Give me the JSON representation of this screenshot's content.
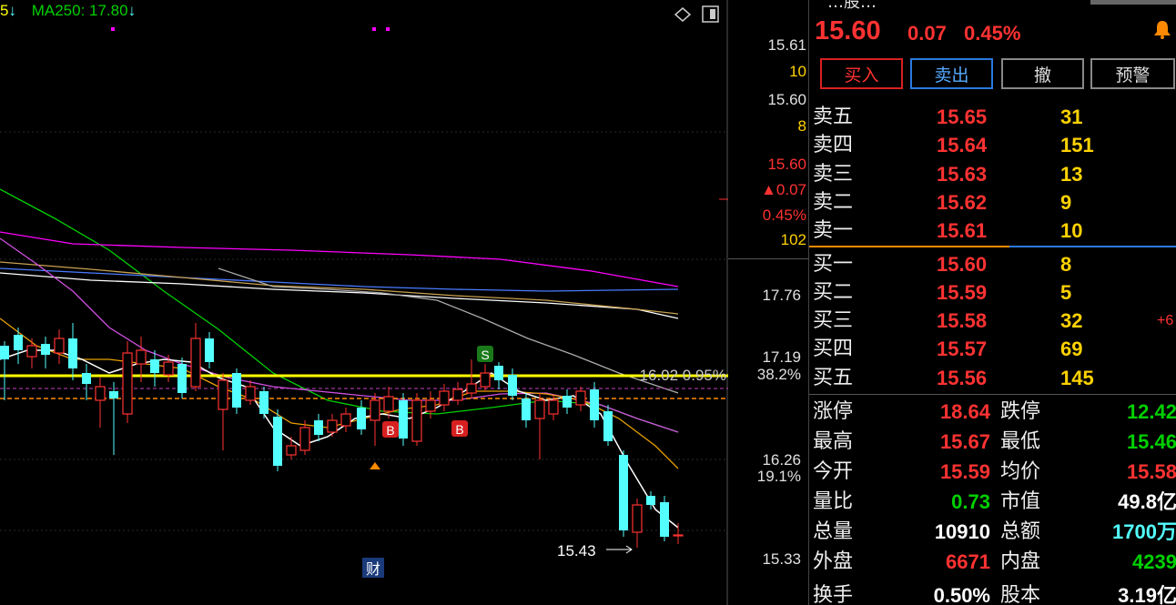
{
  "chart_header": {
    "ma_prefix": "5",
    "ma250_label": "MA250: 17.80",
    "arrow": "↓"
  },
  "chart_annotations": {
    "marker_s": "S",
    "marker_b1": "B",
    "marker_b2": "B",
    "fib_label": "16.02 0.95%",
    "low_label": "15.43",
    "finance_badge": "财"
  },
  "right_axis": {
    "labels": [
      "15.61",
      "10",
      "15.60",
      "8",
      "15.60",
      "▲0.07",
      "0.45%",
      "102",
      "17.76",
      "17.19",
      "38.2%",
      "16.26",
      "19.1%",
      "15.33"
    ]
  },
  "quote": {
    "last_price": "15.60",
    "change": "0.07",
    "change_pct": "0.45%",
    "name_partial": "…股…"
  },
  "buttons": {
    "buy": "买入",
    "sell": "卖出",
    "cancel": "撤",
    "alert": "预警"
  },
  "order_book": {
    "asks": [
      {
        "label": "卖五",
        "price": "15.65",
        "vol": "31"
      },
      {
        "label": "卖四",
        "price": "15.64",
        "vol": "151"
      },
      {
        "label": "卖三",
        "price": "15.63",
        "vol": "13"
      },
      {
        "label": "卖二",
        "price": "15.62",
        "vol": "9"
      },
      {
        "label": "卖一",
        "price": "15.61",
        "vol": "10"
      }
    ],
    "bids": [
      {
        "label": "买一",
        "price": "15.60",
        "vol": "8"
      },
      {
        "label": "买二",
        "price": "15.59",
        "vol": "5"
      },
      {
        "label": "买三",
        "price": "15.58",
        "vol": "32",
        "extra": "+6"
      },
      {
        "label": "买四",
        "price": "15.57",
        "vol": "69"
      },
      {
        "label": "买五",
        "price": "15.56",
        "vol": "145"
      }
    ]
  },
  "stats": [
    {
      "l1": "涨停",
      "v1": "18.64",
      "l2": "跌停",
      "v2": "12.42"
    },
    {
      "l1": "最高",
      "v1": "15.67",
      "l2": "最低",
      "v2": "15.46"
    },
    {
      "l1": "今开",
      "v1": "15.59",
      "l2": "均价",
      "v2": "15.58"
    },
    {
      "l1": "量比",
      "v1": "0.73",
      "l2": "市值",
      "v2": "49.8亿"
    },
    {
      "l1": "总量",
      "v1": "10910",
      "l2": "总额",
      "v2": "1700万"
    },
    {
      "l1": "外盘",
      "v1": "6671",
      "l2": "内盘",
      "v2": "4239"
    },
    {
      "l1": "换手",
      "v1": "0.50%",
      "l2": "股本",
      "v2": "3.19亿"
    }
  ],
  "colors": {
    "up": "#ff3232",
    "down": "#54ffff",
    "yellow": "#ffff00",
    "green": "#00d000",
    "white": "#ffffff",
    "magenta": "#ff00ff",
    "orange": "#ff8a00",
    "blue": "#4a7bff"
  }
}
